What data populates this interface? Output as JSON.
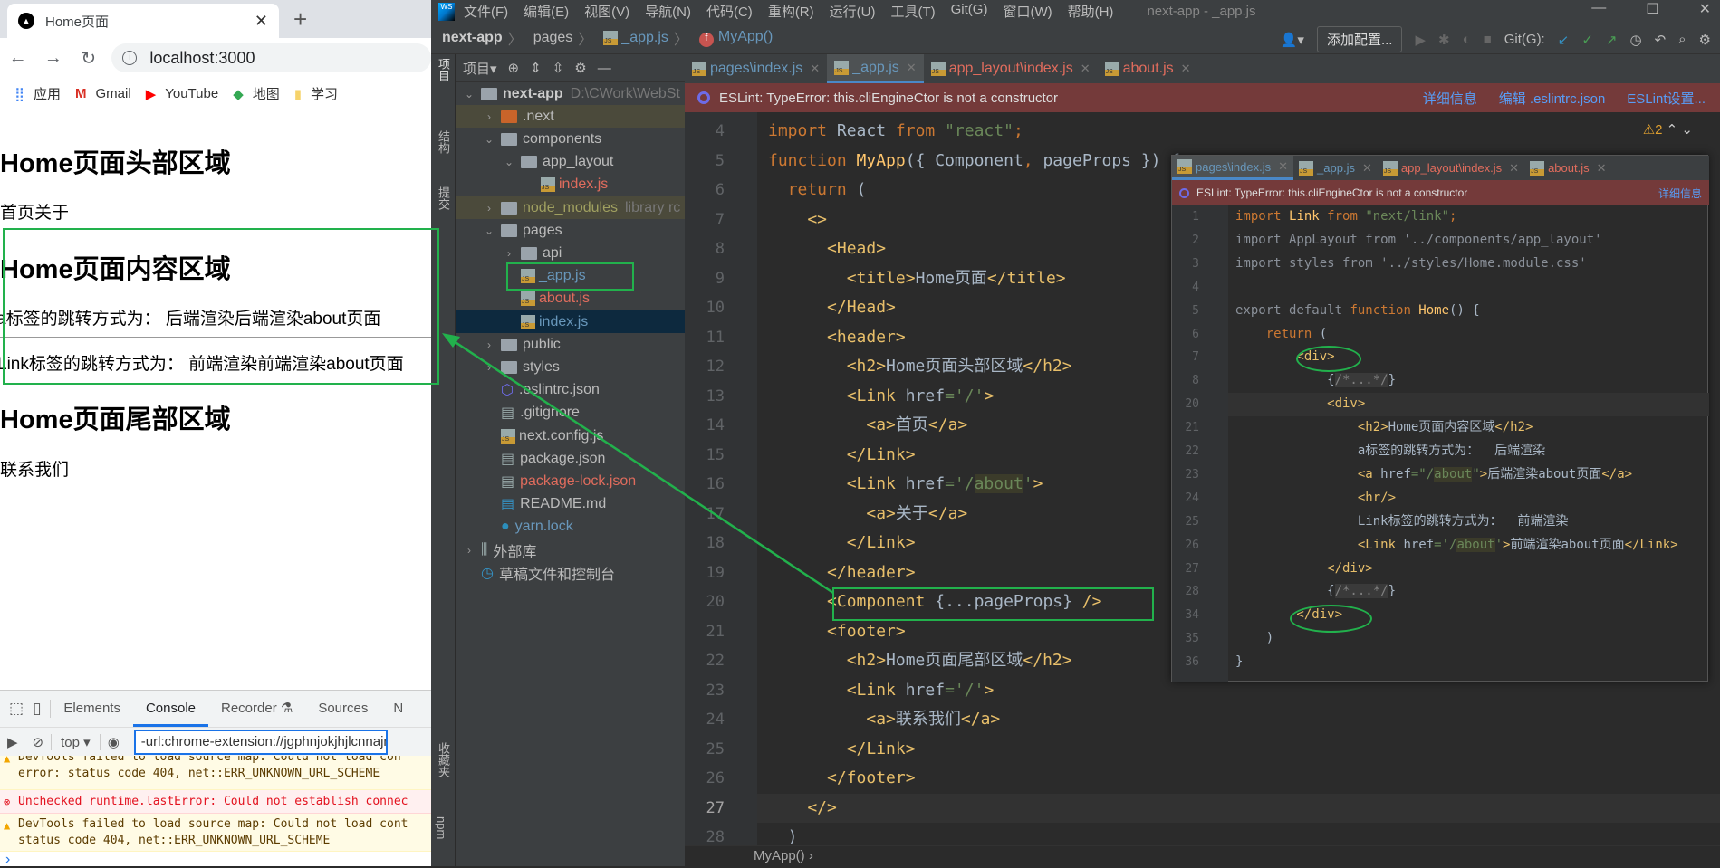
{
  "browser": {
    "tab_title": "Home页面",
    "url": "localhost:3000",
    "bookmarks": [
      "应用",
      "Gmail",
      "YouTube",
      "地图",
      "学习"
    ],
    "page": {
      "header_title": "Home页面头部区域",
      "header_links": "首页关于",
      "content_title": "Home页面内容区域",
      "a_line": "a标签的跳转方式为：  后端渲染后端渲染about页面",
      "link_line": "Link标签的跳转方式为：  前端渲染前端渲染about页面",
      "footer_title": "Home页面尾部区域",
      "footer_link": "联系我们"
    },
    "devtools": {
      "tabs": [
        "Elements",
        "Console",
        "Recorder ⚗",
        "Sources",
        "N"
      ],
      "active_tab": "Console",
      "context": "top ▾",
      "filter": "-url:chrome-extension://jgphnjokjhjlcnnajm",
      "messages": [
        {
          "level": "warning",
          "text": "DevTools failed to load source map: Could not load con\nerror: status code 404, net::ERR_UNKNOWN_URL_SCHEME"
        },
        {
          "level": "error",
          "text": "Unchecked runtime.lastError: Could not establish connec"
        },
        {
          "level": "warning",
          "text": "DevTools failed to load source map: Could not load cont\nstatus code 404, net::ERR_UNKNOWN_URL_SCHEME"
        }
      ],
      "prompt": "›"
    }
  },
  "ide": {
    "menu": [
      "文件(F)",
      "编辑(E)",
      "视图(V)",
      "导航(N)",
      "代码(C)",
      "重构(R)",
      "运行(U)",
      "工具(T)",
      "Git(G)",
      "窗口(W)",
      "帮助(H)"
    ],
    "window_title": "next-app - _app.js",
    "breadcrumb": [
      "next-app",
      "pages",
      "_app.js",
      "MyApp()"
    ],
    "add_config": "添加配置...",
    "git_label": "Git(G):",
    "side_labels": [
      "项目",
      "结构",
      "提交",
      "收藏夹",
      "npm"
    ],
    "project_header": "项目▾",
    "tree": [
      {
        "name": "next-app",
        "hint": "D:\\CWork\\WebSt",
        "depth": 0,
        "arrow": "⌄",
        "kind": "folder",
        "style": "root"
      },
      {
        "name": ".next",
        "depth": 1,
        "arrow": "›",
        "kind": "folder-orange",
        "style": "excluded"
      },
      {
        "name": "components",
        "depth": 1,
        "arrow": "⌄",
        "kind": "folder"
      },
      {
        "name": "app_layout",
        "depth": 2,
        "arrow": "⌄",
        "kind": "folder"
      },
      {
        "name": "index.js",
        "depth": 3,
        "kind": "js",
        "color": "red"
      },
      {
        "name": "node_modules",
        "hint": "library rc",
        "depth": 1,
        "arrow": "›",
        "kind": "folder",
        "style": "excluded",
        "color": "ylw"
      },
      {
        "name": "pages",
        "depth": 1,
        "arrow": "⌄",
        "kind": "folder"
      },
      {
        "name": "api",
        "depth": 2,
        "arrow": "›",
        "kind": "folder"
      },
      {
        "name": "_app.js",
        "depth": 2,
        "kind": "js",
        "color": "blue"
      },
      {
        "name": "about.js",
        "depth": 2,
        "kind": "js",
        "color": "red"
      },
      {
        "name": "index.js",
        "depth": 2,
        "kind": "js",
        "color": "blue",
        "style": "selected"
      },
      {
        "name": "public",
        "depth": 1,
        "arrow": "›",
        "kind": "folder"
      },
      {
        "name": "styles",
        "depth": 1,
        "arrow": "›",
        "kind": "folder"
      },
      {
        "name": ".eslintrc.json",
        "depth": 1,
        "kind": "eslint"
      },
      {
        "name": ".gitignore",
        "depth": 1,
        "kind": "file"
      },
      {
        "name": "next.config.js",
        "depth": 1,
        "kind": "js"
      },
      {
        "name": "package.json",
        "depth": 1,
        "kind": "file"
      },
      {
        "name": "package-lock.json",
        "depth": 1,
        "kind": "file",
        "color": "red"
      },
      {
        "name": "README.md",
        "depth": 1,
        "kind": "md"
      },
      {
        "name": "yarn.lock",
        "depth": 1,
        "kind": "yarn",
        "color": "blue"
      },
      {
        "name": "外部库",
        "depth": 0,
        "arrow": "›",
        "kind": "lib"
      },
      {
        "name": "草稿文件和控制台",
        "depth": 0,
        "kind": "scratch"
      }
    ],
    "editor_tabs": [
      {
        "label": "pages\\index.js",
        "color": "blue"
      },
      {
        "label": "_app.js",
        "color": "blue",
        "active": true
      },
      {
        "label": "app_layout\\index.js",
        "color": "red"
      },
      {
        "label": "about.js",
        "color": "red"
      }
    ],
    "eslint_message": "ESLint: TypeError: this.cliEngineCtor is not a constructor",
    "eslint_links": [
      "详细信息",
      "编辑 .eslintrc.json",
      "ESLint设置..."
    ],
    "warning_count": "⚠2",
    "current_line": 27,
    "code": [
      {
        "n": 4,
        "t": [
          [
            "import ",
            "kw"
          ],
          [
            "React ",
            "txt"
          ],
          [
            "from ",
            "kw"
          ],
          [
            "\"react\"",
            "str"
          ],
          [
            ";",
            "kw"
          ]
        ]
      },
      {
        "n": 5,
        "t": [
          [
            "function ",
            "kw"
          ],
          [
            "MyApp",
            "fn"
          ],
          [
            "({ Component",
            "txt"
          ],
          [
            ", ",
            "kw"
          ],
          [
            "pageProps })",
            "txt"
          ],
          [
            " {",
            "txt"
          ]
        ]
      },
      {
        "n": 6,
        "t": [
          [
            "  return ",
            "kw"
          ],
          [
            "(",
            "txt"
          ]
        ]
      },
      {
        "n": 7,
        "t": [
          [
            "    <>",
            "tag"
          ]
        ]
      },
      {
        "n": 8,
        "t": [
          [
            "      <Head>",
            "tag"
          ]
        ]
      },
      {
        "n": 9,
        "t": [
          [
            "        <title>",
            "tag"
          ],
          [
            "Home页面",
            "txt"
          ],
          [
            "</title>",
            "tag"
          ]
        ]
      },
      {
        "n": 10,
        "t": [
          [
            "      </Head>",
            "tag"
          ]
        ]
      },
      {
        "n": 11,
        "t": [
          [
            "      <header>",
            "tag"
          ]
        ]
      },
      {
        "n": 12,
        "t": [
          [
            "        <h2>",
            "tag"
          ],
          [
            "Home页面头部区域",
            "txt"
          ],
          [
            "</h2>",
            "tag"
          ]
        ]
      },
      {
        "n": 13,
        "t": [
          [
            "        <Link ",
            "tag"
          ],
          [
            "href",
            "txt"
          ],
          [
            "='/'",
            "str"
          ],
          [
            ">",
            "tag"
          ]
        ]
      },
      {
        "n": 14,
        "t": [
          [
            "          <a>",
            "tag"
          ],
          [
            "首页",
            "txt"
          ],
          [
            "</a>",
            "tag"
          ]
        ]
      },
      {
        "n": 15,
        "t": [
          [
            "        </Link>",
            "tag"
          ]
        ]
      },
      {
        "n": 16,
        "t": [
          [
            "        <Link ",
            "tag"
          ],
          [
            "href",
            "txt"
          ],
          [
            "='/",
            "str"
          ],
          [
            "about",
            "hl"
          ],
          [
            "'",
            "str"
          ],
          [
            ">",
            "tag"
          ]
        ]
      },
      {
        "n": 17,
        "t": [
          [
            "          <a>",
            "tag"
          ],
          [
            "关于",
            "txt"
          ],
          [
            "</a>",
            "tag"
          ]
        ]
      },
      {
        "n": 18,
        "t": [
          [
            "        </Link>",
            "tag"
          ]
        ]
      },
      {
        "n": 19,
        "t": [
          [
            "      </header>",
            "tag"
          ]
        ]
      },
      {
        "n": 20,
        "t": [
          [
            "      <Component ",
            "tag"
          ],
          [
            "{...pageProps}",
            "txt"
          ],
          [
            " />",
            "tag"
          ]
        ]
      },
      {
        "n": 21,
        "t": [
          [
            "      <footer>",
            "tag"
          ]
        ]
      },
      {
        "n": 22,
        "t": [
          [
            "        <h2>",
            "tag"
          ],
          [
            "Home页面尾部区域",
            "txt"
          ],
          [
            "</h2>",
            "tag"
          ]
        ]
      },
      {
        "n": 23,
        "t": [
          [
            "        <Link ",
            "tag"
          ],
          [
            "href",
            "txt"
          ],
          [
            "='/'",
            "str"
          ],
          [
            ">",
            "tag"
          ]
        ]
      },
      {
        "n": 24,
        "t": [
          [
            "          <a>",
            "tag"
          ],
          [
            "联系我们",
            "txt"
          ],
          [
            "</a>",
            "tag"
          ]
        ]
      },
      {
        "n": 25,
        "t": [
          [
            "        </Link>",
            "tag"
          ]
        ]
      },
      {
        "n": 26,
        "t": [
          [
            "      </footer>",
            "tag"
          ]
        ]
      },
      {
        "n": 27,
        "t": [
          [
            "    </>",
            "tag"
          ]
        ]
      },
      {
        "n": 28,
        "t": [
          [
            "  )",
            "txt"
          ]
        ]
      }
    ],
    "bottom_breadcrumb": "MyApp()  ›",
    "popup": {
      "tabs": [
        {
          "label": "pages\\index.js",
          "color": "blue",
          "active": true
        },
        {
          "label": "_app.js",
          "color": "blue"
        },
        {
          "label": "app_layout\\index.js",
          "color": "red"
        },
        {
          "label": "about.js",
          "color": "red"
        }
      ],
      "eslint_message": "ESLint: TypeError: this.cliEngineCtor is not a constructor",
      "eslint_link": "详细信息",
      "current_line": 20,
      "code": [
        {
          "n": 1,
          "t": [
            [
              "import ",
              "kw"
            ],
            [
              "Link ",
              "fn"
            ],
            [
              "from ",
              "kw"
            ],
            [
              "\"next/link\"",
              "str"
            ],
            [
              ";",
              "kw"
            ]
          ]
        },
        {
          "n": 2,
          "t": [
            [
              "import AppLayout from '../components/app_layout'",
              "cmdim"
            ]
          ]
        },
        {
          "n": 3,
          "t": [
            [
              "import styles from '../styles/Home.module.css'",
              "cmdim"
            ]
          ]
        },
        {
          "n": 4,
          "t": []
        },
        {
          "n": 5,
          "t": [
            [
              "export default ",
              "cmdim"
            ],
            [
              "function ",
              "kw"
            ],
            [
              "Home",
              "fn"
            ],
            [
              "() {",
              "txt"
            ]
          ]
        },
        {
          "n": 6,
          "t": [
            [
              "    return ",
              "kw"
            ],
            [
              "(",
              "txt"
            ]
          ]
        },
        {
          "n": 7,
          "t": [
            [
              "        <div>",
              "tag"
            ]
          ]
        },
        {
          "n": 8,
          "t": [
            [
              "            {",
              "txt"
            ],
            [
              "/*...*/",
              "cm"
            ],
            [
              "}",
              "txt"
            ]
          ]
        },
        {
          "n": 20,
          "t": [
            [
              "            <div>",
              "tag"
            ]
          ]
        },
        {
          "n": 21,
          "t": [
            [
              "                <h2>",
              "tag"
            ],
            [
              "Home页面内容区域",
              "txt"
            ],
            [
              "</h2>",
              "tag"
            ]
          ]
        },
        {
          "n": 22,
          "t": [
            [
              "                a标签的跳转方式为：  后端渲染",
              "txt"
            ]
          ]
        },
        {
          "n": 23,
          "t": [
            [
              "                <a ",
              "tag"
            ],
            [
              "href",
              "txt"
            ],
            [
              "=\"/",
              "str"
            ],
            [
              "about",
              "hl"
            ],
            [
              "\"",
              "str"
            ],
            [
              ">",
              "tag"
            ],
            [
              "后端渲染about页面",
              "txt"
            ],
            [
              "</a>",
              "tag"
            ]
          ]
        },
        {
          "n": 24,
          "t": [
            [
              "                <hr/>",
              "tag"
            ]
          ]
        },
        {
          "n": 25,
          "t": [
            [
              "                Link标签的跳转方式为：  前端渲染",
              "txt"
            ]
          ]
        },
        {
          "n": 26,
          "t": [
            [
              "                <Link ",
              "tag"
            ],
            [
              "href",
              "txt"
            ],
            [
              "='/",
              "str"
            ],
            [
              "about",
              "hl"
            ],
            [
              "'",
              "str"
            ],
            [
              ">",
              "tag"
            ],
            [
              "前端渲染about页面",
              "txt"
            ],
            [
              "</Link>",
              "tag"
            ]
          ]
        },
        {
          "n": 27,
          "t": [
            [
              "            </div>",
              "tag"
            ]
          ]
        },
        {
          "n": 28,
          "t": [
            [
              "            {",
              "txt"
            ],
            [
              "/*...*/",
              "cm"
            ],
            [
              "}",
              "txt"
            ]
          ]
        },
        {
          "n": 34,
          "t": [
            [
              "        </div>",
              "tag"
            ]
          ]
        },
        {
          "n": 35,
          "t": [
            [
              "    )",
              "txt"
            ]
          ]
        },
        {
          "n": 36,
          "t": [
            [
              "}",
              "txt"
            ]
          ]
        }
      ]
    }
  },
  "colors": {
    "annotation": "#22b14c",
    "eslint_bar": "#743a3a",
    "ide_bg": "#2b2b2b",
    "panel": "#3c3f41",
    "accent": "#4a88c7"
  }
}
